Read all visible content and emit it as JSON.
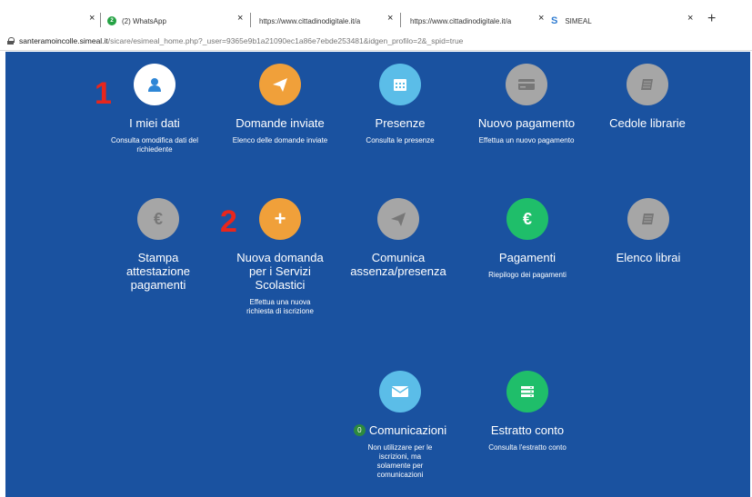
{
  "browser": {
    "tabs": [
      {
        "label": "",
        "close": "×"
      },
      {
        "label": "(2) WhatsApp",
        "close": "×",
        "badge": "2"
      },
      {
        "label": "https://www.cittadinodigitale.it/a",
        "close": "×"
      },
      {
        "label": "https://www.cittadinodigitale.it/a",
        "close": "×"
      },
      {
        "label": "SIMEAL",
        "close": "×"
      }
    ],
    "new_tab": "+",
    "url_host": "santeramoincolle.simeal.it",
    "url_path": "/sicare/esimeal_home.php?_user=9365e9b1a21090ec1a86e7ebde253481&idgen_profilo=2&_spid=true"
  },
  "annotations": {
    "one": "1",
    "two": "2"
  },
  "menu": {
    "miei_dati": {
      "title": "I miei dati",
      "desc": "Consulta omodifica dati del richiedente",
      "icon": "user-icon",
      "color": "#ffffff"
    },
    "domande_inviate": {
      "title": "Domande inviate",
      "desc": "Elenco delle domande inviate",
      "icon": "paper-plane-icon",
      "color": "#f0a03a"
    },
    "presenze": {
      "title": "Presenze",
      "desc": "Consulta le presenze",
      "icon": "calendar-icon",
      "color": "#5bbde8"
    },
    "nuovo_pagamento": {
      "title": "Nuovo pagamento",
      "desc": "Effettua un nuovo pagamento",
      "icon": "credit-card-icon",
      "color": "#a6a6a6"
    },
    "cedole_librarie": {
      "title": "Cedole librarie",
      "desc": "",
      "icon": "book-icon",
      "color": "#a6a6a6"
    },
    "stampa": {
      "title": "Stampa attestazione pagamenti",
      "desc": "",
      "icon": "euro-icon",
      "color": "#a6a6a6"
    },
    "nuova_domanda": {
      "title": "Nuova domanda per i Servizi Scolastici",
      "desc": "Effettua una nuova richiesta di iscrizione",
      "icon": "plus-icon",
      "color": "#f0a03a"
    },
    "comunica": {
      "title": "Comunica assenza/presenza",
      "desc": "",
      "icon": "paper-plane-icon",
      "color": "#a6a6a6"
    },
    "pagamenti": {
      "title": "Pagamenti",
      "desc": "Riepilogo dei pagamenti",
      "icon": "euro-icon",
      "color": "#1fbe6a"
    },
    "elenco_librai": {
      "title": "Elenco librai",
      "desc": "",
      "icon": "book-icon",
      "color": "#a6a6a6"
    },
    "comunicazioni": {
      "title": "Comunicazioni",
      "badge": "0",
      "desc": "Non utilizzare per le iscrizioni, ma solamente per comunicazioni",
      "icon": "envelope-icon",
      "color": "#5bbde8"
    },
    "estratto_conto": {
      "title": "Estratto conto",
      "desc": "Consulta l'estratto conto",
      "icon": "list-icon",
      "color": "#1fbe6a"
    }
  }
}
